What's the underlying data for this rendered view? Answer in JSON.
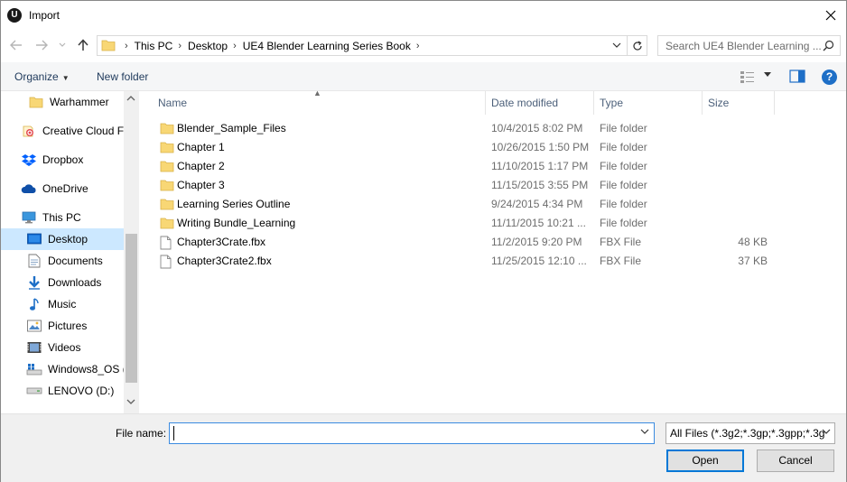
{
  "window": {
    "title": "Import",
    "icons": {
      "app": "unreal-engine-logo",
      "close": "close-icon"
    }
  },
  "navigation": {
    "back": "back-arrow-icon",
    "forward": "forward-arrow-icon",
    "recent": "chevron-down-icon",
    "up": "up-arrow-icon",
    "breadcrumbs": [
      "This PC",
      "Desktop",
      "UE4 Blender Learning Series Book"
    ],
    "search_placeholder": "Search UE4 Blender Learning ..."
  },
  "toolbar": {
    "organize_label": "Organize",
    "new_folder_label": "New folder"
  },
  "sidebar": {
    "items": [
      {
        "label": "Warhammer",
        "icon": "folder-icon"
      },
      {
        "label": "Creative Cloud Fil",
        "icon": "creative-cloud-icon"
      },
      {
        "label": "Dropbox",
        "icon": "dropbox-icon"
      },
      {
        "label": "OneDrive",
        "icon": "onedrive-icon"
      },
      {
        "label": "This PC",
        "icon": "computer-icon"
      },
      {
        "label": "Desktop",
        "icon": "desktop-icon",
        "selected": true
      },
      {
        "label": "Documents",
        "icon": "documents-icon"
      },
      {
        "label": "Downloads",
        "icon": "downloads-icon"
      },
      {
        "label": "Music",
        "icon": "music-icon"
      },
      {
        "label": "Pictures",
        "icon": "pictures-icon"
      },
      {
        "label": "Videos",
        "icon": "videos-icon"
      },
      {
        "label": "Windows8_OS (C",
        "icon": "windows-drive-icon"
      },
      {
        "label": "LENOVO (D:)",
        "icon": "drive-icon"
      }
    ]
  },
  "file_list": {
    "columns": [
      "Name",
      "Date modified",
      "Type",
      "Size"
    ],
    "rows": [
      {
        "name": "Blender_Sample_Files",
        "date": "10/4/2015 8:02 PM",
        "type": "File folder",
        "size": "",
        "kind": "folder"
      },
      {
        "name": "Chapter 1",
        "date": "10/26/2015 1:50 PM",
        "type": "File folder",
        "size": "",
        "kind": "folder"
      },
      {
        "name": "Chapter 2",
        "date": "11/10/2015 1:17 PM",
        "type": "File folder",
        "size": "",
        "kind": "folder"
      },
      {
        "name": "Chapter 3",
        "date": "11/15/2015 3:55 PM",
        "type": "File folder",
        "size": "",
        "kind": "folder"
      },
      {
        "name": "Learning Series Outline",
        "date": "9/24/2015 4:34 PM",
        "type": "File folder",
        "size": "",
        "kind": "folder"
      },
      {
        "name": "Writing Bundle_Learning",
        "date": "11/11/2015 10:21 ...",
        "type": "File folder",
        "size": "",
        "kind": "folder"
      },
      {
        "name": "Chapter3Crate.fbx",
        "date": "11/2/2015 9:20 PM",
        "type": "FBX File",
        "size": "48 KB",
        "kind": "file"
      },
      {
        "name": "Chapter3Crate2.fbx",
        "date": "11/25/2015 12:10 ...",
        "type": "FBX File",
        "size": "37 KB",
        "kind": "file"
      }
    ]
  },
  "footer": {
    "file_name_label": "File name:",
    "file_name_value": "",
    "file_type": "All Files (*.3g2;*.3gp;*.3gpp;*.3g",
    "open_label": "Open",
    "cancel_label": "Cancel"
  },
  "colors": {
    "selection": "#cce8ff",
    "accent": "#0078d7",
    "folder": "#f8d775",
    "header_text": "#4c607a"
  }
}
